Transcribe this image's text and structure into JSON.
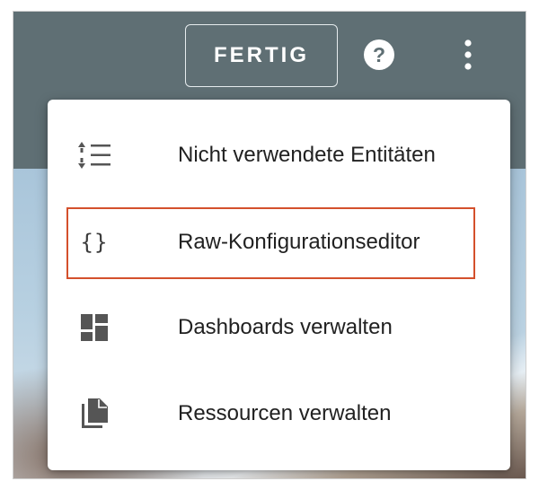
{
  "toolbar": {
    "done_label": "FERTIG",
    "help_icon": "help-circle-icon",
    "more_icon": "more-vertical-icon",
    "background_color": "#5f6f74"
  },
  "menu": {
    "items": [
      {
        "label": "Nicht verwendete Entitäten",
        "icon": "sort-list-icon"
      },
      {
        "label": "Raw-Konfigurationseditor",
        "icon": "code-braces-icon",
        "icon_text": "{}",
        "highlighted": true
      },
      {
        "label": "Dashboards verwalten",
        "icon": "dashboard-grid-icon"
      },
      {
        "label": "Ressourcen verwalten",
        "icon": "file-copy-icon"
      }
    ],
    "highlight_color": "#d4502c"
  }
}
